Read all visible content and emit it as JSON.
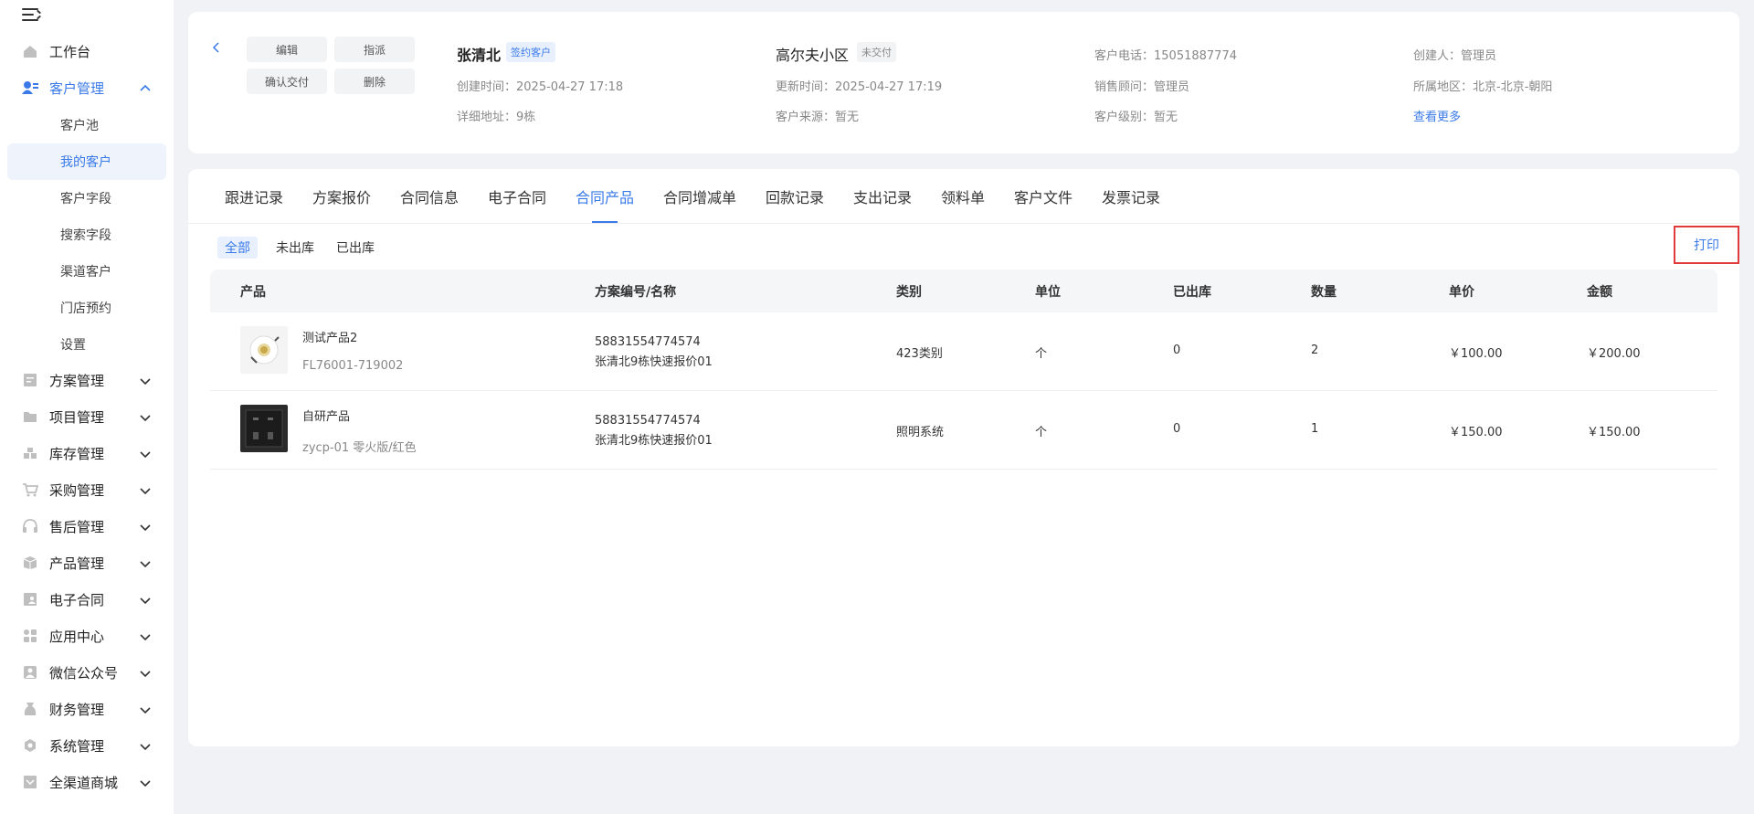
{
  "sidebar": {
    "items": [
      {
        "label": "工作台",
        "icon": "home-icon"
      },
      {
        "label": "客户管理",
        "icon": "customer-icon"
      },
      {
        "label": "方案管理",
        "icon": "plan-icon"
      },
      {
        "label": "项目管理",
        "icon": "folder-icon"
      },
      {
        "label": "库存管理",
        "icon": "inventory-icon"
      },
      {
        "label": "采购管理",
        "icon": "cart-icon"
      },
      {
        "label": "售后管理",
        "icon": "headset-icon"
      },
      {
        "label": "产品管理",
        "icon": "box-icon"
      },
      {
        "label": "电子合同",
        "icon": "contract-icon"
      },
      {
        "label": "应用中心",
        "icon": "apps-icon"
      },
      {
        "label": "微信公众号",
        "icon": "wechat-icon"
      },
      {
        "label": "财务管理",
        "icon": "finance-icon"
      },
      {
        "label": "系统管理",
        "icon": "settings-icon"
      },
      {
        "label": "全渠道商城",
        "icon": "mall-icon"
      }
    ],
    "sub_items": [
      {
        "label": "客户池"
      },
      {
        "label": "我的客户"
      },
      {
        "label": "客户字段"
      },
      {
        "label": "搜索字段"
      },
      {
        "label": "渠道客户"
      },
      {
        "label": "门店预约"
      },
      {
        "label": "设置"
      }
    ]
  },
  "header": {
    "buttons": {
      "edit": "编辑",
      "assign": "指派",
      "confirm": "确认交付",
      "delete": "删除"
    },
    "customer": {
      "name": "张清北",
      "tag": "签约客户",
      "created": "创建时间：2025-04-27 17:18",
      "address": "详细地址：9栋"
    },
    "project": {
      "name": "高尔夫小区",
      "tag": "未交付",
      "updated": "更新时间：2025-04-27 17:19",
      "source": "客户来源：暂无"
    },
    "contact": {
      "phone": "客户电话：15051887774",
      "sales": "销售顾问：管理员",
      "level": "客户级别：暂无"
    },
    "meta": {
      "creator": "创建人：管理员",
      "region": "所属地区：北京-北京-朝阳",
      "more": "查看更多"
    }
  },
  "tabs": [
    "跟进记录",
    "方案报价",
    "合同信息",
    "电子合同",
    "合同产品",
    "合同增减单",
    "回款记录",
    "支出记录",
    "领料单",
    "客户文件",
    "发票记录"
  ],
  "active_tab": "合同产品",
  "filters": [
    "全部",
    "未出库",
    "已出库"
  ],
  "print_label": "打印",
  "table": {
    "headers": [
      "产品",
      "方案编号/名称",
      "类别",
      "单位",
      "已出库",
      "数量",
      "单价",
      "金额"
    ],
    "rows": [
      {
        "name": "测试产品2",
        "code": "FL76001-719002",
        "plan_no": "58831554774574",
        "plan_name": "张清北9栋快速报价01",
        "category": "423类别",
        "unit": "个",
        "shipped": "0",
        "qty": "2",
        "price": "￥100.00",
        "amount": "￥200.00"
      },
      {
        "name": "自研产品",
        "code": "zycp-01 零火版/红色",
        "plan_no": "58831554774574",
        "plan_name": "张清北9栋快速报价01",
        "category": "照明系统",
        "unit": "个",
        "shipped": "0",
        "qty": "1",
        "price": "￥150.00",
        "amount": "￥150.00"
      }
    ]
  },
  "colors": {
    "accent": "#3a7ae8",
    "highlight_border": "#e03a3a"
  }
}
